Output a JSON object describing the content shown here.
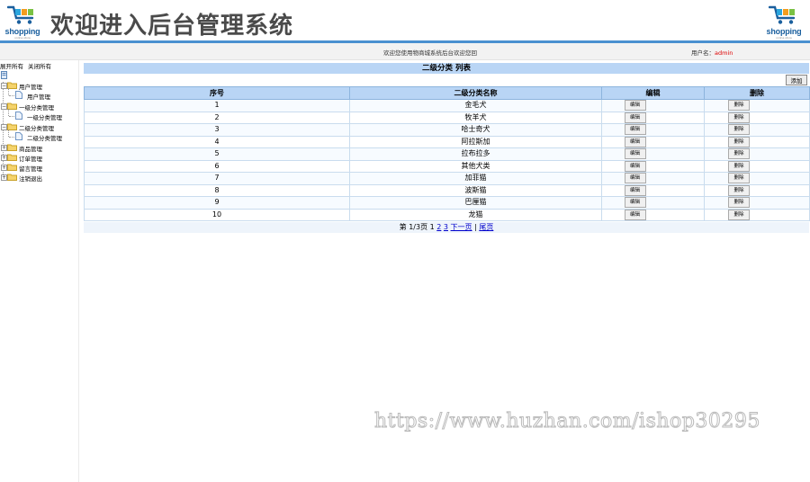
{
  "header": {
    "title": "欢迎进入后台管理系统",
    "logo_text": "shopping",
    "logo_subtext": "online store"
  },
  "infobar": {
    "welcome": "欢迎您使用物商城系统后台欢迎您回",
    "user_label": "用户名：",
    "user_name": "admin"
  },
  "sidebar": {
    "expand_all": "展开所有",
    "collapse_all": "关闭所有",
    "tree": [
      {
        "label": "用户管理",
        "children": [
          "用户管理"
        ]
      },
      {
        "label": "一级分类管理",
        "children": [
          "一级分类管理"
        ]
      },
      {
        "label": "二级分类管理",
        "children": [
          "二级分类管理"
        ]
      },
      {
        "label": "商品管理",
        "children": []
      },
      {
        "label": "订单管理",
        "children": []
      },
      {
        "label": "留言管理",
        "children": []
      },
      {
        "label": "注销退出",
        "children": []
      }
    ]
  },
  "main": {
    "title": "二级分类 列表",
    "add_label": "添加",
    "columns": [
      "序号",
      "二级分类名称",
      "编辑",
      "删除"
    ],
    "edit_label": "编辑",
    "delete_label": "删除",
    "rows": [
      {
        "id": "1",
        "name": "金毛犬"
      },
      {
        "id": "2",
        "name": "牧羊犬"
      },
      {
        "id": "3",
        "name": "哈士奇犬"
      },
      {
        "id": "4",
        "name": "阿拉斯加"
      },
      {
        "id": "5",
        "name": "拉布拉多"
      },
      {
        "id": "6",
        "name": "其他犬类"
      },
      {
        "id": "7",
        "name": "加菲猫"
      },
      {
        "id": "8",
        "name": "波斯猫"
      },
      {
        "id": "9",
        "name": "巴厘猫"
      },
      {
        "id": "10",
        "name": "龙猫"
      }
    ],
    "pager": {
      "summary": "第 1/3页",
      "current": "1",
      "page2": "2",
      "page3": "3",
      "next": "下一页",
      "separator": "|",
      "last": "尾页"
    }
  },
  "watermark": "https://www.huzhan.com/ishop30295",
  "colors": {
    "accent": "#4a90d0",
    "header_cell": "#b9d5f5",
    "user_name": "#dd0000",
    "link": "#0000cc"
  }
}
